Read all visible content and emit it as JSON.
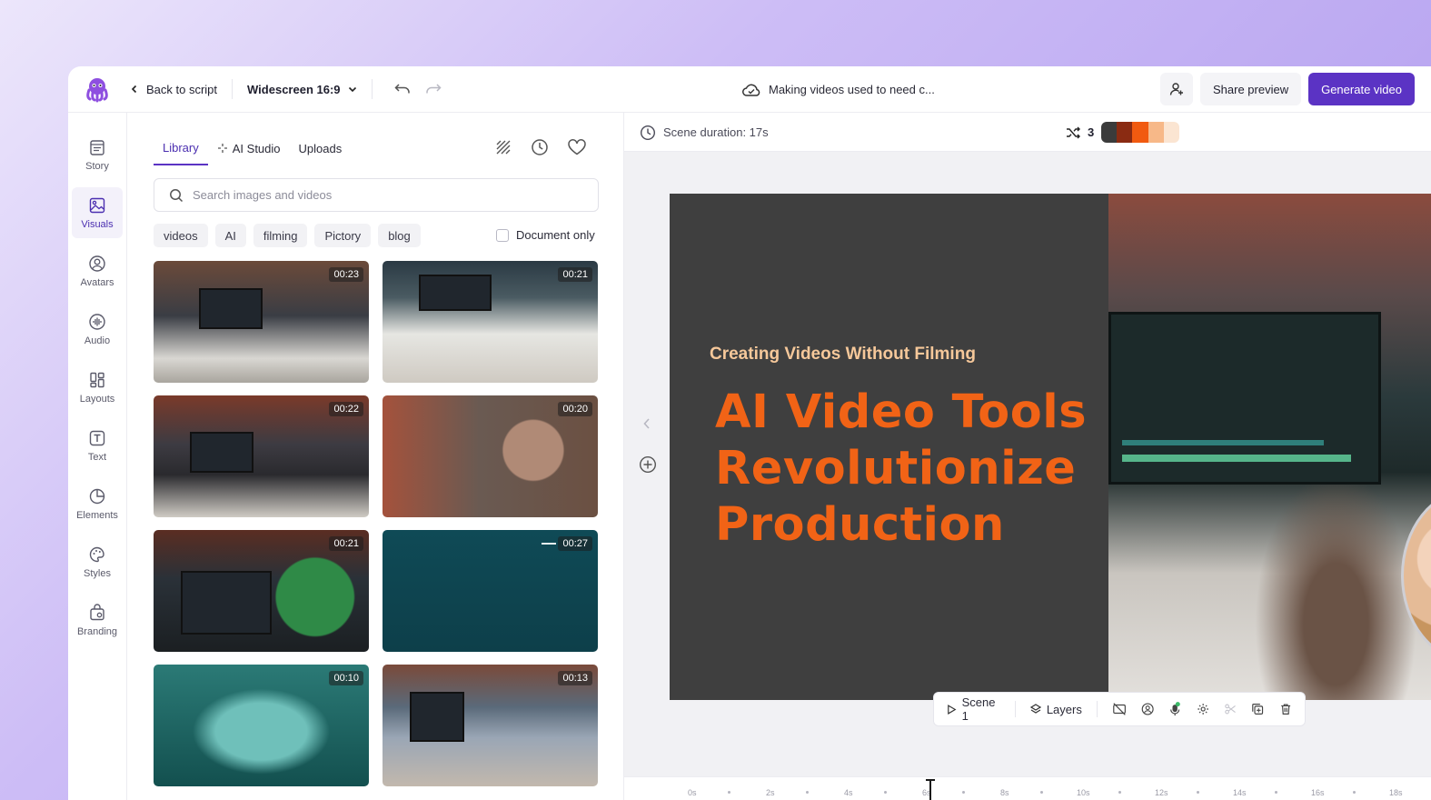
{
  "header": {
    "back_label": "Back to script",
    "aspect_label": "Widescreen 16:9",
    "project_title": "Making videos used to need c...",
    "share_label": "Share preview",
    "generate_label": "Generate video"
  },
  "rail": {
    "items": [
      {
        "label": "Story",
        "icon": "story-icon"
      },
      {
        "label": "Visuals",
        "icon": "image-icon"
      },
      {
        "label": "Avatars",
        "icon": "avatar-icon"
      },
      {
        "label": "Audio",
        "icon": "audio-icon"
      },
      {
        "label": "Layouts",
        "icon": "layouts-icon"
      },
      {
        "label": "Text",
        "icon": "text-icon"
      },
      {
        "label": "Elements",
        "icon": "elements-icon"
      },
      {
        "label": "Styles",
        "icon": "palette-icon"
      },
      {
        "label": "Branding",
        "icon": "branding-icon"
      }
    ],
    "active": "Visuals"
  },
  "library": {
    "tabs": [
      "Library",
      "AI Studio",
      "Uploads"
    ],
    "active_tab": "Library",
    "search_placeholder": "Search images and videos",
    "chips": [
      "videos",
      "AI",
      "filming",
      "Pictory",
      "blog"
    ],
    "document_only_label": "Document only",
    "items": [
      {
        "duration": "00:23"
      },
      {
        "duration": "00:21"
      },
      {
        "duration": "00:22"
      },
      {
        "duration": "00:20"
      },
      {
        "duration": "00:21"
      },
      {
        "duration": "00:27"
      },
      {
        "duration": "00:10"
      },
      {
        "duration": "00:13"
      }
    ]
  },
  "scene": {
    "duration_label": "Scene duration: 17s",
    "shuffle_count": "3",
    "palette": [
      "#3b3b3b",
      "#8a2b12",
      "#f15a10",
      "#f7b888",
      "#fbe5d2"
    ],
    "subtitle": "Creating Videos Without Filming",
    "headline_lines": [
      "AI Video Tools",
      "Revolutionize",
      "Production"
    ],
    "accent_color": "#f16316"
  },
  "toolbar": {
    "scene_label": "Scene 1",
    "layers_label": "Layers"
  },
  "timeline": {
    "ticks": [
      "0s",
      "2s",
      "4s",
      "6s",
      "8s",
      "10s",
      "12s",
      "14s",
      "16s",
      "18s"
    ]
  }
}
